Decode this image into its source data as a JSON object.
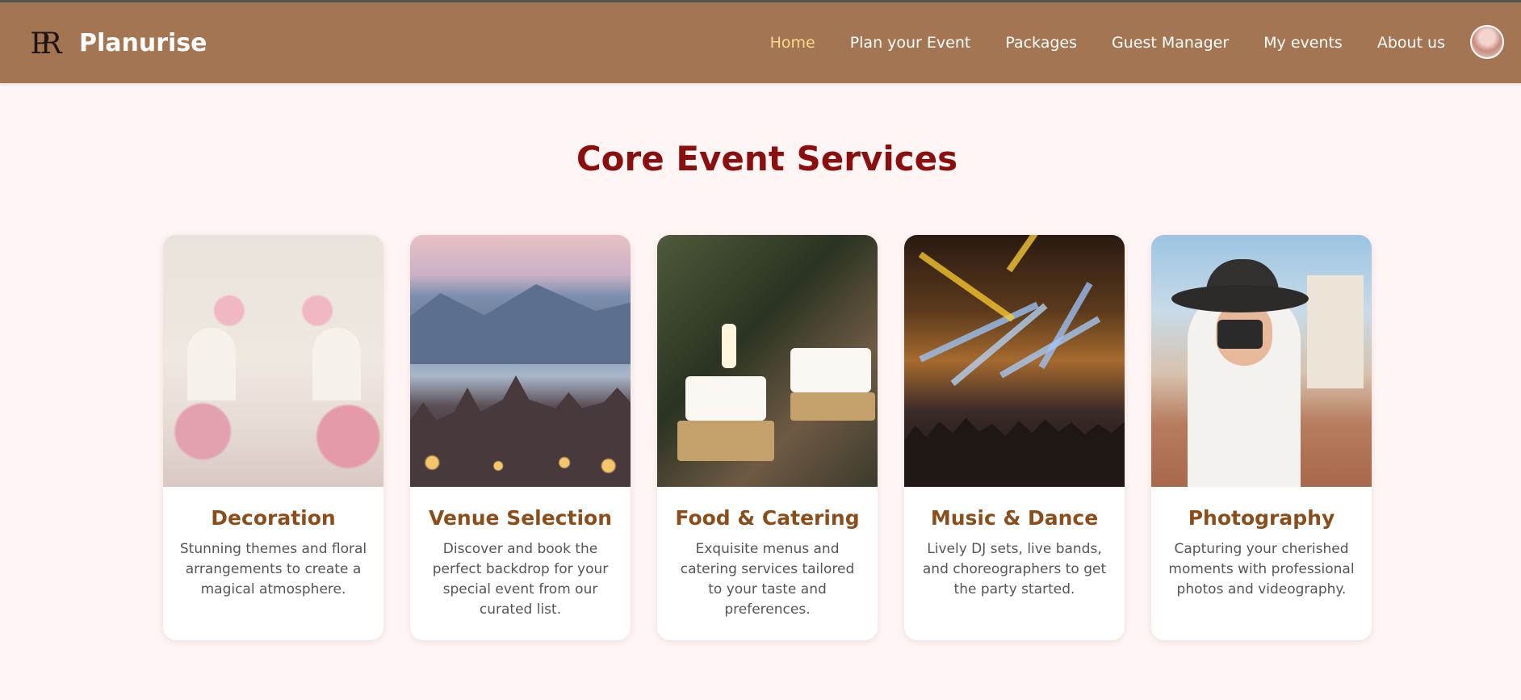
{
  "header": {
    "logo_text": "PR",
    "brand": "Planurise",
    "nav": [
      {
        "label": "Home",
        "active": true
      },
      {
        "label": "Plan your Event",
        "active": false
      },
      {
        "label": "Packages",
        "active": false
      },
      {
        "label": "Guest Manager",
        "active": false
      },
      {
        "label": "My events",
        "active": false
      },
      {
        "label": "About us",
        "active": false
      }
    ]
  },
  "main": {
    "title": "Core Event Services",
    "cards": [
      {
        "title": "Decoration",
        "description": "Stunning themes and floral arrangements to create a magical atmosphere."
      },
      {
        "title": "Venue Selection",
        "description": "Discover and book the perfect backdrop for your special event from our curated list."
      },
      {
        "title": "Food & Catering",
        "description": "Exquisite menus and catering services tailored to your taste and preferences."
      },
      {
        "title": "Music & Dance",
        "description": "Lively DJ sets, live bands, and choreographers to get the party started."
      },
      {
        "title": "Photography",
        "description": "Capturing your cherished moments with professional photos and videography."
      }
    ]
  },
  "colors": {
    "navbar": "#a47552",
    "active_nav": "#ffd889",
    "page_bg": "#fff5f5",
    "section_title": "#8b0f0f",
    "card_title": "#8a4e1c"
  }
}
